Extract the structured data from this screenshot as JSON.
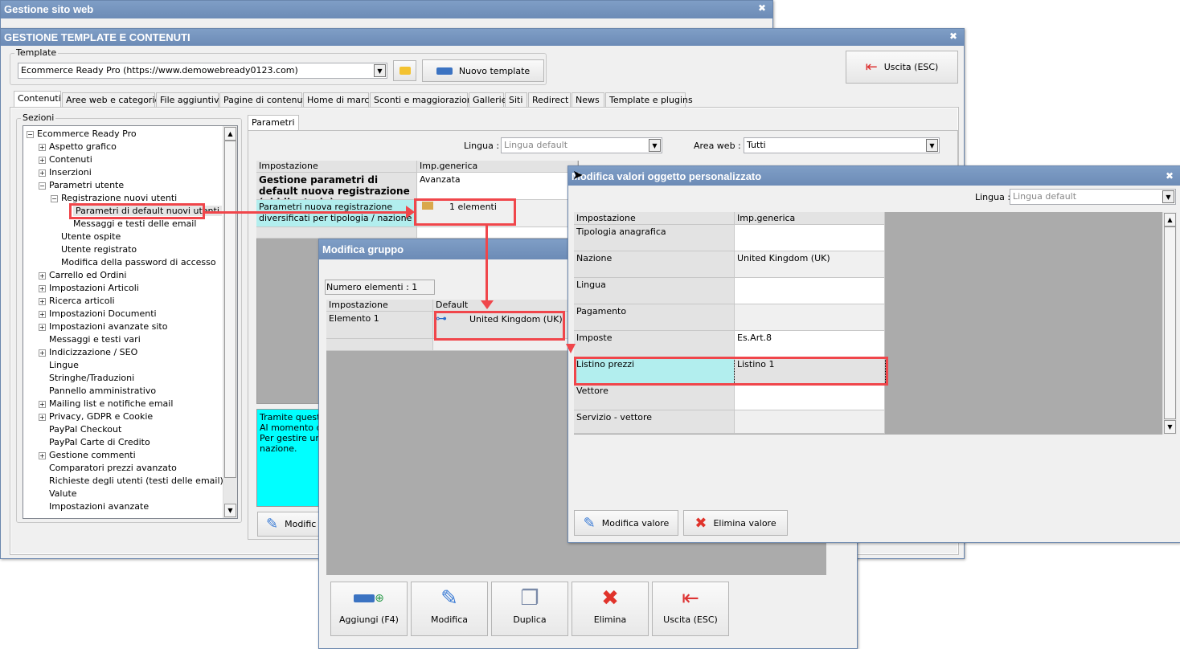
{
  "bg_window": {
    "title": "Gestione sito web"
  },
  "main": {
    "title": "GESTIONE TEMPLATE E CONTENUTI",
    "template_legend": "Template",
    "template_value": "Ecommerce Ready Pro (https://www.demowebready0123.com)",
    "new_template": "Nuovo template",
    "exit": "Uscita (ESC)",
    "tabs": [
      "Contenuti",
      "Aree web e categorie",
      "File aggiuntivi",
      "Pagine di contenuti",
      "Home di marca",
      "Sconti e maggiorazioni",
      "Gallerie",
      "Siti",
      "Redirect",
      "News",
      "Template e plugins"
    ],
    "sections_legend": "Sezioni",
    "tree": [
      {
        "label": "Ecommerce Ready Pro",
        "level": 0,
        "exp": "-"
      },
      {
        "label": "Aspetto grafico",
        "level": 1,
        "exp": "+"
      },
      {
        "label": "Contenuti",
        "level": 1,
        "exp": "+"
      },
      {
        "label": "Inserzioni",
        "level": 1,
        "exp": "+"
      },
      {
        "label": "Parametri utente",
        "level": 1,
        "exp": "-"
      },
      {
        "label": "Registrazione nuovi utenti",
        "level": 2,
        "exp": "-"
      },
      {
        "label": "Parametri di default nuovi utenti",
        "level": 3,
        "exp": "",
        "selected": true
      },
      {
        "label": "Messaggi e testi delle email",
        "level": 3,
        "exp": ""
      },
      {
        "label": "Utente ospite",
        "level": 2,
        "exp": ""
      },
      {
        "label": "Utente registrato",
        "level": 2,
        "exp": ""
      },
      {
        "label": "Modifica della password di accesso",
        "level": 2,
        "exp": ""
      },
      {
        "label": "Carrello ed Ordini",
        "level": 1,
        "exp": "+"
      },
      {
        "label": "Impostazioni Articoli",
        "level": 1,
        "exp": "+"
      },
      {
        "label": "Ricerca articoli",
        "level": 1,
        "exp": "+"
      },
      {
        "label": "Impostazioni Documenti",
        "level": 1,
        "exp": "+"
      },
      {
        "label": "Impostazioni avanzate sito",
        "level": 1,
        "exp": "+"
      },
      {
        "label": "Messaggi e testi vari",
        "level": 1,
        "exp": ""
      },
      {
        "label": "Indicizzazione / SEO",
        "level": 1,
        "exp": "+"
      },
      {
        "label": "Lingue",
        "level": 1,
        "exp": ""
      },
      {
        "label": "Stringhe/Traduzioni",
        "level": 1,
        "exp": ""
      },
      {
        "label": "Pannello amministrativo",
        "level": 1,
        "exp": ""
      },
      {
        "label": "Mailing list e notifiche email",
        "level": 1,
        "exp": "+"
      },
      {
        "label": "Privacy, GDPR e Cookie",
        "level": 1,
        "exp": "+"
      },
      {
        "label": "PayPal Checkout",
        "level": 1,
        "exp": ""
      },
      {
        "label": "PayPal Carte di Credito",
        "level": 1,
        "exp": ""
      },
      {
        "label": "Gestione commenti",
        "level": 1,
        "exp": "+"
      },
      {
        "label": "Comparatori prezzi avanzato",
        "level": 1,
        "exp": ""
      },
      {
        "label": "Richieste degli utenti (testi delle email)",
        "level": 1,
        "exp": ""
      },
      {
        "label": "Valute",
        "level": 1,
        "exp": ""
      },
      {
        "label": "Impostazioni avanzate",
        "level": 1,
        "exp": ""
      }
    ],
    "params_tab": "Parametri",
    "lingua_label": "Lingua :",
    "lingua_value": "Lingua default",
    "area_label": "Area web :",
    "area_value": "Tutti",
    "grid_headers": [
      "Impostazione",
      "Imp.generica"
    ],
    "grid_rows": [
      {
        "key": "Gestione parametri di default nuova registrazione (obbligatorio)",
        "value": "Avanzata"
      },
      {
        "key": "Parametri nuova registrazione diversificati per tipologia / nazione",
        "value": "1 elementi"
      }
    ],
    "description": [
      "Tramite questa",
      "Al momento dell",
      "Per gestire un s",
      "nazione."
    ],
    "modify": "Modific"
  },
  "group": {
    "title": "Modifica gruppo",
    "count": "Numero elementi : 1",
    "headers": [
      "Impostazione",
      "Default"
    ],
    "row": {
      "key": "Elemento 1",
      "value": "United Kingdom (UK)"
    },
    "buttons": [
      "Aggiungi (F4)",
      "Modifica",
      "Duplica",
      "Elimina",
      "Uscita (ESC)"
    ]
  },
  "custom": {
    "title": "Modifica valori oggetto personalizzato",
    "lingua_label": "Lingua :",
    "lingua_value": "Lingua default",
    "headers": [
      "Impostazione",
      "Imp.generica"
    ],
    "rows": [
      {
        "key": "Tipologia anagrafica",
        "value": ""
      },
      {
        "key": "Nazione",
        "value": "United Kingdom (UK)"
      },
      {
        "key": "Lingua",
        "value": ""
      },
      {
        "key": "Pagamento",
        "value": ""
      },
      {
        "key": "Imposte",
        "value": "Es.Art.8"
      },
      {
        "key": "Listino prezzi",
        "value": "Listino 1"
      },
      {
        "key": "Vettore",
        "value": ""
      },
      {
        "key": "Servizio - vettore",
        "value": ""
      }
    ],
    "edit_value": "Modifica valore",
    "delete_value": "Elimina valore"
  }
}
